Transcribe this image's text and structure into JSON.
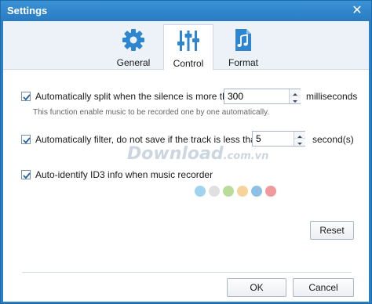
{
  "window": {
    "title": "Settings",
    "close_glyph": "✕"
  },
  "tabs": [
    {
      "label": "General",
      "icon": "gear-icon",
      "active": false
    },
    {
      "label": "Control",
      "icon": "sliders-icon",
      "active": true
    },
    {
      "label": "Format",
      "icon": "music-file-icon",
      "active": false
    }
  ],
  "options": {
    "split": {
      "checked": true,
      "label": "Automatically split when the silence is more than",
      "value": "300",
      "unit": "milliseconds",
      "hint": "This function enable music to be recorded one by one automatically."
    },
    "filter": {
      "checked": true,
      "label": "Automatically filter, do not save if the track is less than",
      "value": "5",
      "unit": "second(s)"
    },
    "id3": {
      "checked": true,
      "label": "Auto-identify ID3 info when music recorder"
    }
  },
  "watermark": {
    "text": "Download",
    "suffix": ".com.vn",
    "dot_colors": [
      "#9fd3ef",
      "#e0e0e0",
      "#b9dc9a",
      "#f7d39a",
      "#8ec0e6",
      "#f19a9a"
    ]
  },
  "buttons": {
    "reset": "Reset",
    "ok": "OK",
    "cancel": "Cancel"
  },
  "colors": {
    "title_bar": "#2b7fc4",
    "tab_icon": "#2d86cf"
  }
}
